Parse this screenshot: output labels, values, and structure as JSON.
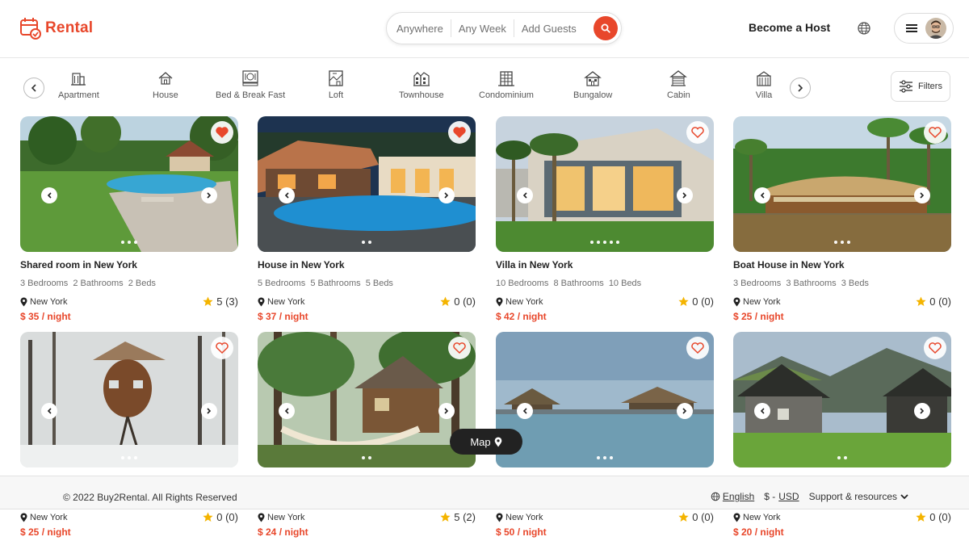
{
  "brand": {
    "name": "Rental"
  },
  "search": {
    "where": "Anywhere",
    "when": "Any Week",
    "guests": "Add Guests"
  },
  "header": {
    "become_host": "Become a Host"
  },
  "categories": [
    {
      "label": "Apartment",
      "icon": "apartment-icon"
    },
    {
      "label": "House",
      "icon": "house-icon"
    },
    {
      "label": "Bed & Break Fast",
      "icon": "bed-breakfast-icon"
    },
    {
      "label": "Loft",
      "icon": "loft-icon"
    },
    {
      "label": "Townhouse",
      "icon": "townhouse-icon"
    },
    {
      "label": "Condominium",
      "icon": "condominium-icon"
    },
    {
      "label": "Bungalow",
      "icon": "bungalow-icon"
    },
    {
      "label": "Cabin",
      "icon": "cabin-icon"
    },
    {
      "label": "Villa",
      "icon": "villa-icon"
    }
  ],
  "filters": {
    "label": "Filters"
  },
  "listings": [
    {
      "title": "Shared room in New York",
      "bedrooms": "3 Bedrooms",
      "bathrooms": "2 Bathrooms",
      "beds": "2 Beds",
      "location": "New York",
      "rating": "5 (3)",
      "price": "$ 35 / night",
      "favorited": true,
      "scene": "resort-pool"
    },
    {
      "title": "House in New York",
      "bedrooms": "5 Bedrooms",
      "bathrooms": "5 Bathrooms",
      "beds": "5 Beds",
      "location": "New York",
      "rating": "0 (0)",
      "price": "$ 37 / night",
      "favorited": true,
      "scene": "villa-pool-night"
    },
    {
      "title": "Villa in New York",
      "bedrooms": "10 Bedrooms",
      "bathrooms": "8 Bathrooms",
      "beds": "10 Beds",
      "location": "New York",
      "rating": "0 (0)",
      "price": "$ 42 / night",
      "favorited": false,
      "scene": "modern-villa-palms"
    },
    {
      "title": "Boat House in New York",
      "bedrooms": "3 Bedrooms",
      "bathrooms": "3 Bathrooms",
      "beds": "3 Beds",
      "location": "New York",
      "rating": "0 (0)",
      "price": "$ 25 / night",
      "favorited": false,
      "scene": "houseboat"
    },
    {
      "location": "New York",
      "rating": "0 (0)",
      "price": "$ 25 / night",
      "favorited": false,
      "scene": "snowy-treehouse"
    },
    {
      "location": "New York",
      "rating": "5 (2)",
      "price": "$ 24 / night",
      "favorited": false,
      "scene": "forest-cabin"
    },
    {
      "location": "New York",
      "rating": "0 (0)",
      "price": "$ 50 / night",
      "favorited": false,
      "scene": "water-bungalows"
    },
    {
      "location": "New York",
      "rating": "0 (0)",
      "price": "$ 20 / night",
      "favorited": false,
      "scene": "turf-houses"
    }
  ],
  "map_button": {
    "label": "Map"
  },
  "footer": {
    "copyright": "© 2022 Buy2Rental. All Rights Reserved",
    "language": "English",
    "currency_symbol": "$ -",
    "currency": "USD",
    "support": "Support & resources"
  },
  "colors": {
    "accent": "#e8472b",
    "star": "#f4b400"
  }
}
